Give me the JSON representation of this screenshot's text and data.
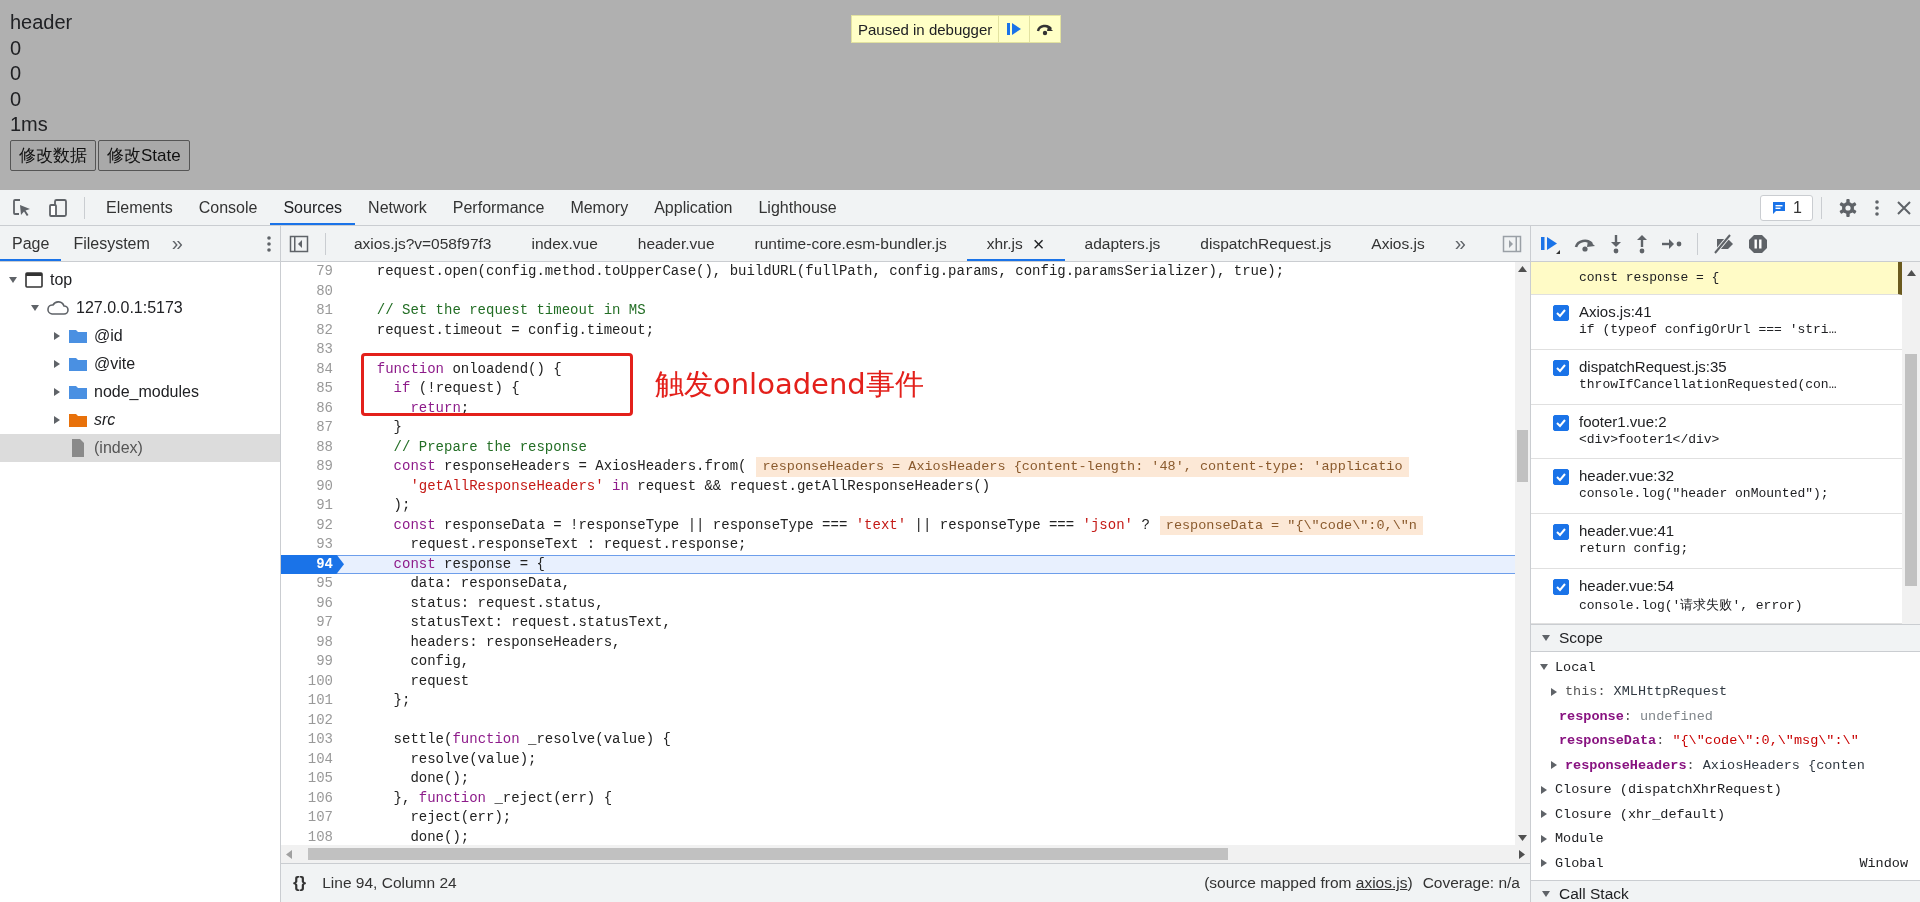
{
  "page": {
    "lines": [
      "header",
      "0",
      "0",
      "0",
      "1ms"
    ],
    "buttons": [
      "修改数据",
      "修改State"
    ]
  },
  "paused_banner": {
    "label": "Paused in debugger"
  },
  "devtools": {
    "tabs": [
      {
        "label": "Elements",
        "selected": false
      },
      {
        "label": "Console",
        "selected": false
      },
      {
        "label": "Sources",
        "selected": true
      },
      {
        "label": "Network",
        "selected": false
      },
      {
        "label": "Performance",
        "selected": false
      },
      {
        "label": "Memory",
        "selected": false
      },
      {
        "label": "Application",
        "selected": false
      },
      {
        "label": "Lighthouse",
        "selected": false
      }
    ],
    "issues_count": "1",
    "navigator": {
      "tabs": [
        {
          "label": "Page",
          "selected": true
        },
        {
          "label": "Filesystem",
          "selected": false
        }
      ],
      "overflow": "»",
      "tree": [
        {
          "label": "top",
          "kind": "frame",
          "expanded": true,
          "selected": false,
          "children": [
            {
              "label": "127.0.0.1:5173",
              "kind": "origin",
              "expanded": true,
              "selected": false,
              "children": [
                {
                  "label": "@id",
                  "kind": "folder",
                  "expanded": false,
                  "selected": false
                },
                {
                  "label": "@vite",
                  "kind": "folder",
                  "expanded": false,
                  "selected": false
                },
                {
                  "label": "node_modules",
                  "kind": "folder",
                  "expanded": false,
                  "selected": false
                },
                {
                  "label": "src",
                  "kind": "authored",
                  "expanded": false,
                  "selected": false
                },
                {
                  "label": "(index)",
                  "kind": "file",
                  "selected": true
                }
              ]
            }
          ]
        }
      ]
    },
    "editor": {
      "tabs": [
        {
          "label": "axios.js?v=058f97f3",
          "selected": false
        },
        {
          "label": "index.vue",
          "selected": false
        },
        {
          "label": "header.vue",
          "selected": false
        },
        {
          "label": "runtime-core.esm-bundler.js",
          "selected": false
        },
        {
          "label": "xhr.js",
          "selected": true,
          "close": "×"
        },
        {
          "label": "adapters.js",
          "selected": false
        },
        {
          "label": "dispatchRequest.js",
          "selected": false
        },
        {
          "label": "Axios.js",
          "selected": false
        }
      ],
      "overflow": "»",
      "lines": [
        {
          "n": "79",
          "paused": false,
          "seg": [
            {
              "kind": "plain",
              "text": "  request.open(config.method.toUpperCase(), buildURL(fullPath, config.params, config.paramsSerializer), true);"
            }
          ]
        },
        {
          "n": "80",
          "paused": false
        },
        {
          "n": "81",
          "paused": false,
          "seg": [
            {
              "kind": "comment",
              "text": "  // Set the request timeout in MS"
            }
          ]
        },
        {
          "n": "82",
          "paused": false,
          "seg": [
            {
              "kind": "plain",
              "text": "  request.timeout = config.timeout;"
            }
          ]
        },
        {
          "n": "83",
          "paused": false
        },
        {
          "n": "84",
          "paused": false,
          "seg": [
            {
              "kind": "keyword",
              "text": "  function"
            },
            {
              "kind": "plain",
              "text": " onloadend() {"
            }
          ]
        },
        {
          "n": "85",
          "paused": false,
          "seg": [
            {
              "kind": "keyword",
              "text": "    if"
            },
            {
              "kind": "plain",
              "text": " (!request) {"
            }
          ]
        },
        {
          "n": "86",
          "paused": false,
          "seg": [
            {
              "kind": "keyword",
              "text": "      return"
            },
            {
              "kind": "plain",
              "text": ";"
            }
          ]
        },
        {
          "n": "87",
          "paused": false,
          "seg": [
            {
              "kind": "plain",
              "text": "    }"
            }
          ]
        },
        {
          "n": "88",
          "paused": false,
          "seg": [
            {
              "kind": "comment",
              "text": "    // Prepare the response"
            }
          ]
        },
        {
          "n": "89",
          "paused": false,
          "seg": [
            {
              "kind": "keyword",
              "text": "    const"
            },
            {
              "kind": "plain",
              "text": " responseHeaders = AxiosHeaders.from("
            }
          ],
          "inline_value": "responseHeaders = AxiosHeaders {content-length: '48', content-type: 'applicatio"
        },
        {
          "n": "90",
          "paused": false,
          "seg": [
            {
              "kind": "string",
              "text": "      'getAllResponseHeaders'"
            },
            {
              "kind": "keyword",
              "text": " in"
            },
            {
              "kind": "plain",
              "text": " request && request.getAllResponseHeaders()"
            }
          ]
        },
        {
          "n": "91",
          "paused": false,
          "seg": [
            {
              "kind": "plain",
              "text": "    );"
            }
          ]
        },
        {
          "n": "92",
          "paused": false,
          "seg": [
            {
              "kind": "keyword",
              "text": "    const"
            },
            {
              "kind": "plain",
              "text": " responseData = !responseType || responseType === "
            },
            {
              "kind": "string",
              "text": "'text'"
            },
            {
              "kind": "plain",
              "text": " || responseType === "
            },
            {
              "kind": "string",
              "text": "'json'"
            },
            {
              "kind": "plain",
              "text": " ?"
            }
          ],
          "inline_value": "responseData = \"{\\\"code\\\":0,\\\"n"
        },
        {
          "n": "93",
          "paused": false,
          "seg": [
            {
              "kind": "plain",
              "text": "      request.responseText : request.response;"
            }
          ]
        },
        {
          "n": "94",
          "paused": true,
          "seg": [
            {
              "kind": "keyword",
              "text": "    const"
            },
            {
              "kind": "plain",
              "text": " response = {"
            }
          ]
        },
        {
          "n": "95",
          "paused": false,
          "seg": [
            {
              "kind": "plain",
              "text": "      data: responseData,"
            }
          ]
        },
        {
          "n": "96",
          "paused": false,
          "seg": [
            {
              "kind": "plain",
              "text": "      status: request.status,"
            }
          ]
        },
        {
          "n": "97",
          "paused": false,
          "seg": [
            {
              "kind": "plain",
              "text": "      statusText: request.statusText,"
            }
          ]
        },
        {
          "n": "98",
          "paused": false,
          "seg": [
            {
              "kind": "plain",
              "text": "      headers: responseHeaders,"
            }
          ]
        },
        {
          "n": "99",
          "paused": false,
          "seg": [
            {
              "kind": "plain",
              "text": "      config,"
            }
          ]
        },
        {
          "n": "100",
          "paused": false,
          "seg": [
            {
              "kind": "plain",
              "text": "      request"
            }
          ]
        },
        {
          "n": "101",
          "paused": false,
          "seg": [
            {
              "kind": "plain",
              "text": "    };"
            }
          ]
        },
        {
          "n": "102",
          "paused": false
        },
        {
          "n": "103",
          "paused": false,
          "seg": [
            {
              "kind": "plain",
              "text": "    settle("
            },
            {
              "kind": "keyword",
              "text": "function"
            },
            {
              "kind": "plain",
              "text": " _resolve(value) {"
            }
          ]
        },
        {
          "n": "104",
          "paused": false,
          "seg": [
            {
              "kind": "plain",
              "text": "      resolve(value);"
            }
          ]
        },
        {
          "n": "105",
          "paused": false,
          "seg": [
            {
              "kind": "plain",
              "text": "      done();"
            }
          ]
        },
        {
          "n": "106",
          "paused": false,
          "seg": [
            {
              "kind": "plain",
              "text": "    }, "
            },
            {
              "kind": "keyword",
              "text": "function"
            },
            {
              "kind": "plain",
              "text": " _reject(err) {"
            }
          ]
        },
        {
          "n": "107",
          "paused": false,
          "seg": [
            {
              "kind": "plain",
              "text": "      reject(err);"
            }
          ]
        },
        {
          "n": "108",
          "paused": false,
          "seg": [
            {
              "kind": "plain",
              "text": "      done();"
            }
          ]
        }
      ],
      "annotation": "触发onloadend事件"
    },
    "status_bar": {
      "format_button": "{}",
      "position": "Line 94, Column 24",
      "source_map_before": "(source mapped from ",
      "source_map_link": "axios.js",
      "source_map_after": ")",
      "coverage": "Coverage: n/a"
    },
    "debugger": {
      "paused_breakpoint": {
        "code": "const response = {"
      },
      "breakpoints": [
        {
          "location": "Axios.js:41",
          "code": "if (typeof configOrUrl === 'stri…",
          "checked": true
        },
        {
          "location": "dispatchRequest.js:35",
          "code": "throwIfCancellationRequested(con…",
          "checked": true
        },
        {
          "location": "footer1.vue:2",
          "code": "<div>footer1</div>",
          "checked": true
        },
        {
          "location": "header.vue:32",
          "code": "console.log(\"header onMounted\");",
          "checked": true
        },
        {
          "location": "header.vue:41",
          "code": "return config;",
          "checked": true
        },
        {
          "location": "header.vue:54",
          "code": "console.log('请求失败', error)",
          "checked": true
        }
      ],
      "scope": {
        "title": "Scope",
        "expanded": true,
        "groups": [
          {
            "label": "Local",
            "expanded": true,
            "rows": [
              {
                "name": "this",
                "own": false,
                "separator": ":",
                "value": "XMLHttpRequest",
                "kind": "object",
                "expandable": true
              },
              {
                "name": "response",
                "own": true,
                "separator": ":",
                "value": "undefined",
                "kind": "undefined",
                "expandable": false
              },
              {
                "name": "responseData",
                "own": true,
                "separator": ":",
                "value": "\"{\\\"code\\\":0,\\\"msg\\\":\\\"",
                "kind": "string",
                "expandable": false
              },
              {
                "name": "responseHeaders",
                "own": true,
                "separator": ":",
                "value": "AxiosHeaders {conten",
                "kind": "object",
                "expandable": true
              }
            ]
          },
          {
            "label": "Closure (dispatchXhrRequest)",
            "expanded": false
          },
          {
            "label": "Closure (xhr_default)",
            "expanded": false
          },
          {
            "label": "Module",
            "expanded": false
          },
          {
            "label": "Global",
            "expanded": false,
            "value": "Window"
          }
        ]
      },
      "call_stack": {
        "title": "Call Stack",
        "expanded": true
      }
    }
  }
}
